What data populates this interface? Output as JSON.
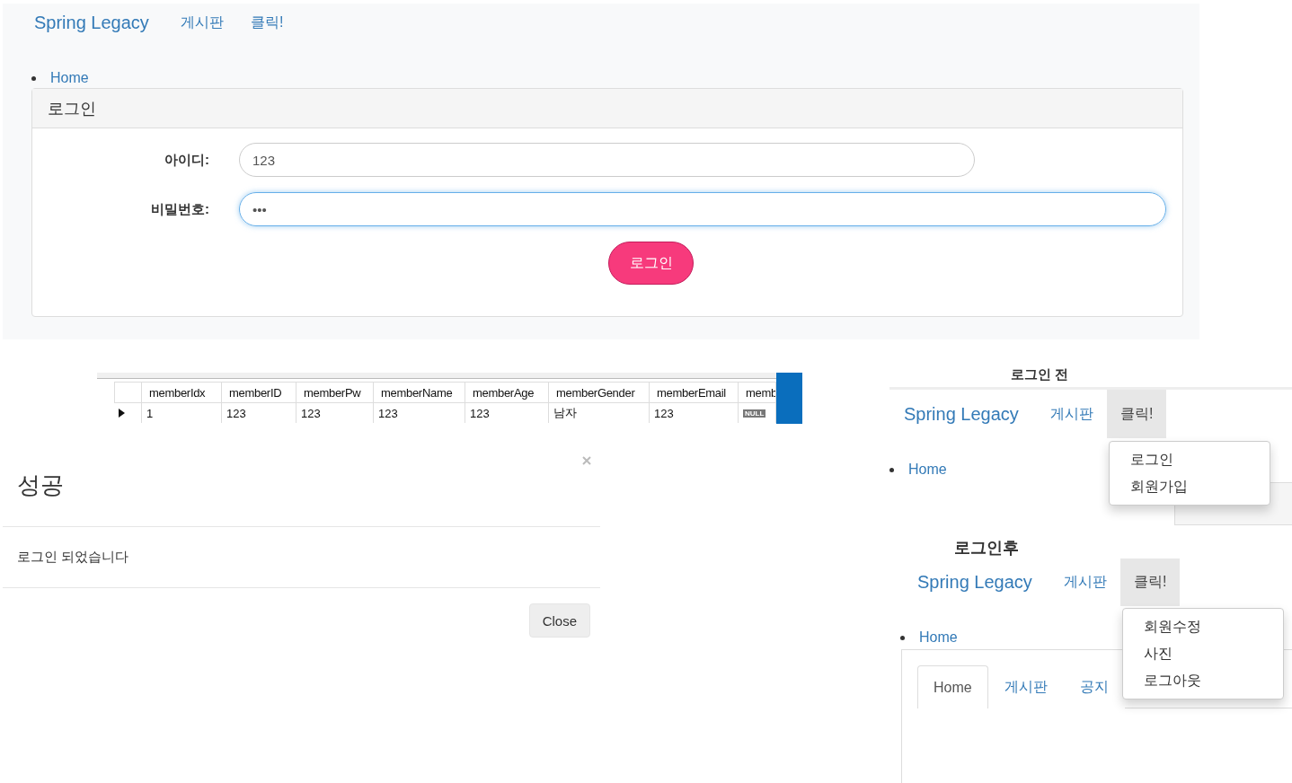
{
  "login_page": {
    "navbar": {
      "brand": "Spring Legacy",
      "links": [
        {
          "label": "게시판",
          "open": false
        },
        {
          "label": "클릭!",
          "open": false
        }
      ]
    },
    "breadcrumb": "Home",
    "card": {
      "title": "로그인",
      "fields": [
        {
          "label": "아이디:",
          "value": "123",
          "focused": false
        },
        {
          "label": "비밀번호:",
          "value": "•••",
          "focused": true
        }
      ],
      "submit": "로그인"
    }
  },
  "db_table": {
    "columns": [
      "memberIdx",
      "memberID",
      "memberPw",
      "memberName",
      "memberAge",
      "memberGender",
      "memberEmail",
      "memb"
    ],
    "rows": [
      {
        "cells": [
          {
            "kind": "text",
            "text": "1"
          },
          {
            "kind": "text",
            "text": "123"
          },
          {
            "kind": "text",
            "text": "123"
          },
          {
            "kind": "text",
            "text": "123"
          },
          {
            "kind": "text",
            "text": "123"
          },
          {
            "kind": "text",
            "text": "남자"
          },
          {
            "kind": "text",
            "text": "123"
          },
          {
            "kind": "null",
            "text": "NULL"
          }
        ]
      }
    ]
  },
  "modal": {
    "title": "성공",
    "message": "로그인 되었습니다",
    "close_button": "Close"
  },
  "before_login": {
    "heading": "로그인 전",
    "navbar": {
      "brand": "Spring Legacy",
      "links": [
        {
          "label": "게시판",
          "open": false
        },
        {
          "label": "클릭!",
          "open": true
        }
      ]
    },
    "breadcrumb": "Home",
    "dropdown": [
      "로그인",
      "회원가입"
    ]
  },
  "after_login": {
    "heading": "로그인후",
    "navbar": {
      "brand": "Spring Legacy",
      "links": [
        {
          "label": "게시판",
          "open": false
        },
        {
          "label": "클릭!",
          "open": true
        }
      ]
    },
    "breadcrumb": "Home",
    "dropdown": [
      "회원수정",
      "사진",
      "로그아웃"
    ],
    "tabs": [
      {
        "label": "Home",
        "selected": true
      },
      {
        "label": "게시판",
        "selected": false
      },
      {
        "label": "공지",
        "selected": false
      }
    ]
  }
}
